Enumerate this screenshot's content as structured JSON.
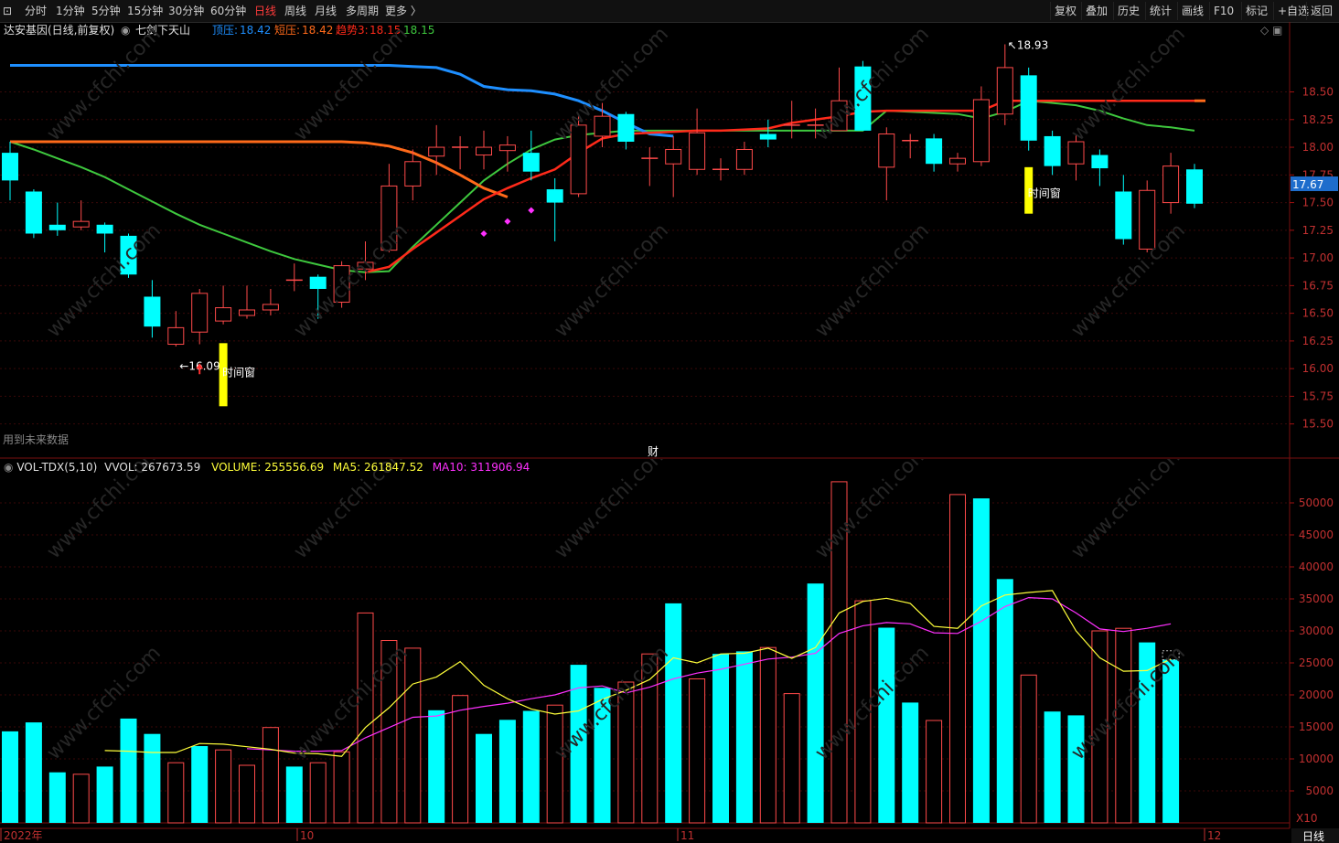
{
  "toolbar": {
    "periods": [
      "分时",
      "1分钟",
      "5分钟",
      "15分钟",
      "30分钟",
      "60分钟",
      "日线",
      "周线",
      "月线",
      "多周期",
      "更多 〉"
    ],
    "active_period": "日线",
    "right_buttons": [
      "复权",
      "叠加",
      "历史",
      "统计",
      "画线",
      "F10",
      "标记",
      "+自选",
      "返回"
    ]
  },
  "chart_header": {
    "stock": "达安基因(日线,前复权)",
    "indicator_name": "七剑下天山",
    "l1": "顶压:",
    "v1": "18.42",
    "l2": "短压:",
    "v2": "18.42",
    "l3": "趋势3:",
    "v3": "18.15",
    "v4": "18.15"
  },
  "colors": {
    "up": "#ff4a4a",
    "down": "#00ffff",
    "blue_line": "#1e8fff",
    "green_line": "#3ec83e",
    "orange_line": "#ff6a1a",
    "red_line": "#ff2a1a",
    "vol_ma5": "#ffff3a",
    "vol_ma10": "#ff30ff",
    "yellow_bar": "#ffff00"
  },
  "annotations": {
    "high_label": "18.93",
    "low_label": "16.09",
    "window_label_1": "时间窗",
    "window_label_2": "时间窗",
    "future_data": "用到未来数据",
    "cai": "财",
    "current_price": "17.67"
  },
  "volume_header": {
    "name": "VOL-TDX(5,10)",
    "vvol": "VVOL: 267673.59",
    "volume": "VOLUME: 255556.69",
    "ma5": "MA5: 261847.52",
    "ma10": "MA10: 311906.94"
  },
  "volume_multiplier": "X10",
  "bottom_right_label": "日线",
  "chart_data": [
    {
      "type": "candlestick",
      "ylim": [
        15.2,
        19.0
      ],
      "y_ticks": [
        "18.50",
        "18.25",
        "18.00",
        "17.75",
        "17.50",
        "17.25",
        "17.00",
        "16.75",
        "16.50",
        "16.25",
        "16.00",
        "15.75",
        "15.50"
      ],
      "candles": [
        [
          17.95,
          17.7,
          18.05,
          17.52
        ],
        [
          17.6,
          17.22,
          17.62,
          17.18
        ],
        [
          17.3,
          17.25,
          17.5,
          17.2
        ],
        [
          17.28,
          17.33,
          17.52,
          17.25
        ],
        [
          17.3,
          17.22,
          17.32,
          17.05
        ],
        [
          17.2,
          16.85,
          17.22,
          16.82
        ],
        [
          16.65,
          16.38,
          16.8,
          16.28
        ],
        [
          16.22,
          16.37,
          16.52,
          16.2
        ],
        [
          16.33,
          16.68,
          16.72,
          16.22
        ],
        [
          16.43,
          16.55,
          16.75,
          16.4
        ],
        [
          16.48,
          16.53,
          16.75,
          16.45
        ],
        [
          16.53,
          16.58,
          16.72,
          16.48
        ],
        [
          16.78,
          16.8,
          16.95,
          16.7
        ],
        [
          16.83,
          16.72,
          16.85,
          16.45
        ],
        [
          16.6,
          16.93,
          16.97,
          16.55
        ],
        [
          16.9,
          16.96,
          17.15,
          16.8
        ],
        [
          17.07,
          17.65,
          17.85,
          17.05
        ],
        [
          17.65,
          17.87,
          17.98,
          17.52
        ],
        [
          17.92,
          18.0,
          18.2,
          17.75
        ],
        [
          17.98,
          18.0,
          18.1,
          17.8
        ],
        [
          17.93,
          18.0,
          18.15,
          17.8
        ],
        [
          17.97,
          18.02,
          18.1,
          17.78
        ],
        [
          17.95,
          17.78,
          18.15,
          17.7
        ],
        [
          17.62,
          17.5,
          17.72,
          17.15
        ],
        [
          17.58,
          18.2,
          18.3,
          17.55
        ],
        [
          18.1,
          18.28,
          18.4,
          18.0
        ],
        [
          18.3,
          18.05,
          18.32,
          17.98
        ],
        [
          17.9,
          17.9,
          18.0,
          17.65
        ],
        [
          17.85,
          17.98,
          18.1,
          17.55
        ],
        [
          17.8,
          18.13,
          18.35,
          17.75
        ],
        [
          17.8,
          17.8,
          17.9,
          17.7
        ],
        [
          17.8,
          17.98,
          18.05,
          17.75
        ],
        [
          18.12,
          18.07,
          18.25,
          18.0
        ],
        [
          18.2,
          18.2,
          18.42,
          18.08
        ],
        [
          18.2,
          18.2,
          18.35,
          18.08
        ],
        [
          18.15,
          18.42,
          18.72,
          18.15
        ],
        [
          18.73,
          18.15,
          18.78,
          18.15
        ],
        [
          17.82,
          18.12,
          18.18,
          17.52
        ],
        [
          18.05,
          18.06,
          18.12,
          17.9
        ],
        [
          18.08,
          17.85,
          18.12,
          17.78
        ],
        [
          17.85,
          17.9,
          17.95,
          17.78
        ],
        [
          17.87,
          18.43,
          18.55,
          17.83
        ],
        [
          18.3,
          18.72,
          18.93,
          18.2
        ],
        [
          18.65,
          18.06,
          18.72,
          17.97
        ],
        [
          18.1,
          17.83,
          18.15,
          17.75
        ],
        [
          17.85,
          18.05,
          18.12,
          17.7
        ],
        [
          17.93,
          17.81,
          17.98,
          17.65
        ],
        [
          17.6,
          17.17,
          17.75,
          17.12
        ],
        [
          17.08,
          17.61,
          17.7,
          17.05
        ],
        [
          17.5,
          17.83,
          17.95,
          17.4
        ],
        [
          17.8,
          17.49,
          17.85,
          17.45
        ]
      ],
      "lines": {
        "blue": [
          18.74,
          18.74,
          18.74,
          18.74,
          18.74,
          18.74,
          18.74,
          18.74,
          18.74,
          18.74,
          18.74,
          18.74,
          18.74,
          18.74,
          18.74,
          18.74,
          18.74,
          18.73,
          18.72,
          18.66,
          18.55,
          18.52,
          18.51,
          18.48,
          18.42,
          18.33,
          18.22,
          18.12,
          18.1
        ],
        "orange": [
          18.05,
          18.05,
          18.05,
          18.05,
          18.05,
          18.05,
          18.05,
          18.05,
          18.05,
          18.05,
          18.05,
          18.05,
          18.05,
          18.05,
          18.05,
          18.04,
          18.01,
          17.95,
          17.86,
          17.75,
          17.63,
          17.55
        ],
        "green": [
          18.05,
          17.98,
          17.9,
          17.82,
          17.73,
          17.62,
          17.51,
          17.4,
          17.3,
          17.22,
          17.14,
          17.06,
          16.99,
          16.94,
          16.89,
          16.87,
          16.88,
          17.1,
          17.3,
          17.5,
          17.7,
          17.85,
          17.98,
          18.07,
          18.11,
          18.13,
          18.15,
          18.15,
          18.15,
          18.15,
          18.15,
          18.15,
          18.15,
          18.15,
          18.15,
          18.15,
          18.15,
          18.33,
          18.32,
          18.31,
          18.3,
          18.26,
          18.32,
          18.42,
          18.4,
          18.38,
          18.33,
          18.26,
          18.2,
          18.18,
          18.15
        ],
        "red": [
          null,
          null,
          null,
          null,
          null,
          null,
          null,
          null,
          null,
          null,
          null,
          null,
          null,
          null,
          null,
          16.87,
          16.92,
          17.08,
          17.23,
          17.38,
          17.53,
          17.63,
          17.72,
          17.8,
          17.95,
          18.08,
          18.12,
          18.13,
          18.14,
          18.15,
          18.15,
          18.16,
          18.17,
          18.22,
          18.25,
          18.28,
          18.32,
          18.33,
          18.33,
          18.33,
          18.33,
          18.33,
          18.42,
          18.42,
          18.42,
          18.42,
          18.42,
          18.42,
          18.42,
          18.42,
          18.42
        ],
        "magenta_dots": [
          [
            20,
            17.22
          ],
          [
            21,
            17.33
          ],
          [
            22,
            17.43
          ]
        ]
      }
    },
    {
      "type": "bar",
      "ylim": [
        0,
        54000
      ],
      "y_ticks": [
        "50000",
        "45000",
        "40000",
        "35000",
        "30000",
        "25000",
        "20000",
        "15000",
        "10000",
        "5000"
      ],
      "volumes": [
        14300,
        15700,
        7900,
        7600,
        8800,
        16300,
        13900,
        9400,
        12000,
        11400,
        9000,
        14900,
        8800,
        9400,
        11100,
        32800,
        28500,
        27300,
        17600,
        19900,
        13900,
        16100,
        17500,
        18400,
        24700,
        21100,
        22000,
        26400,
        34300,
        22500,
        26400,
        26800,
        27400,
        20200,
        37400,
        53300,
        34700,
        30500,
        18800,
        16000,
        51300,
        50700,
        38100,
        23100,
        17400,
        16800,
        30000,
        30400,
        28200,
        25500
      ],
      "vol_up": [
        false,
        false,
        false,
        true,
        false,
        false,
        false,
        true,
        false,
        true,
        true,
        true,
        false,
        true,
        true,
        true,
        true,
        true,
        false,
        true,
        false,
        false,
        false,
        true,
        false,
        false,
        true,
        true,
        false,
        true,
        false,
        false,
        true,
        true,
        false,
        true,
        true,
        false,
        false,
        true,
        true,
        false,
        false,
        true,
        false,
        false,
        true,
        true,
        false,
        false
      ],
      "ma5": [
        null,
        null,
        null,
        null,
        11300,
        11200,
        11000,
        11000,
        12400,
        12300,
        11900,
        11500,
        10900,
        10800,
        10400,
        14900,
        18000,
        21700,
        22800,
        25200,
        21500,
        19400,
        17800,
        17000,
        17500,
        19300,
        20700,
        22400,
        25800,
        25000,
        26400,
        26500,
        27300,
        25700,
        27400,
        32800,
        34600,
        35100,
        34300,
        30700,
        30400,
        33900,
        35600,
        36000,
        36300,
        30000,
        25800,
        23700,
        23800,
        25600
      ],
      "ma10": [
        null,
        null,
        null,
        null,
        null,
        null,
        null,
        null,
        null,
        null,
        11600,
        11400,
        11200,
        11200,
        11300,
        13300,
        14900,
        16500,
        16700,
        17600,
        18200,
        18700,
        19400,
        20000,
        21100,
        21400,
        20300,
        21200,
        22500,
        23400,
        24000,
        24800,
        25600,
        25900,
        26500,
        29600,
        30800,
        31300,
        31100,
        29700,
        29600,
        31500,
        33800,
        35200,
        35000,
        32800,
        30300,
        29900,
        30400,
        31100
      ]
    }
  ],
  "x_axis": {
    "labels": [
      "2022年",
      "10",
      "11",
      "12"
    ]
  }
}
